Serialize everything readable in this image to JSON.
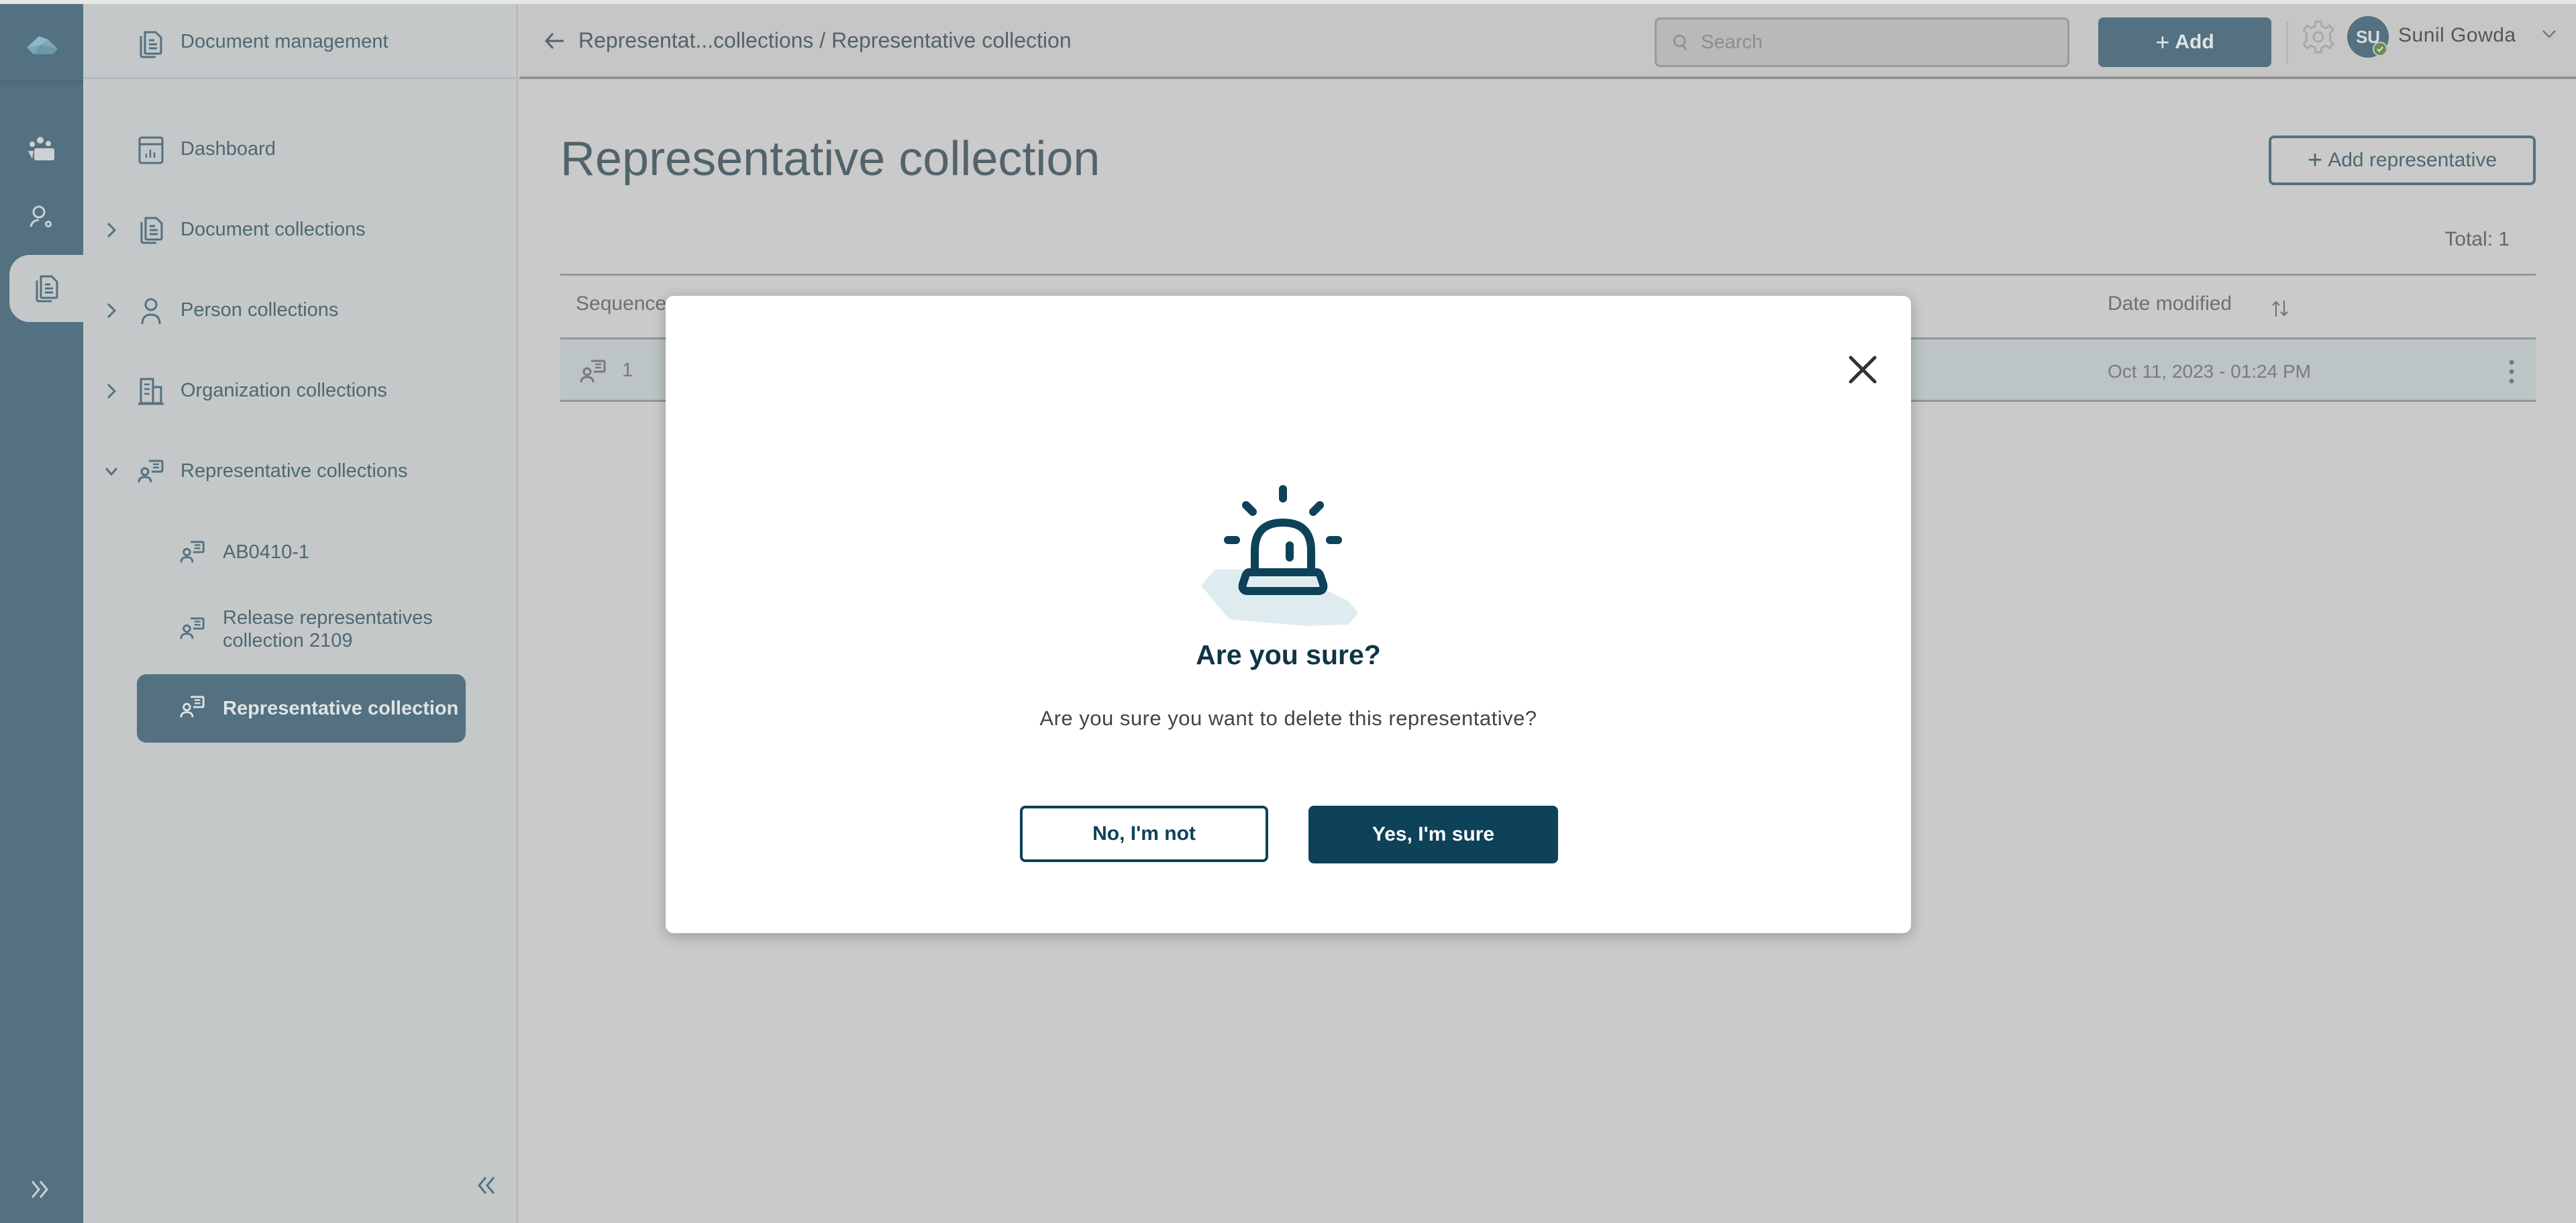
{
  "app": {
    "section_title": "Document management"
  },
  "rail": {
    "items": [
      {
        "icon": "users-folder-icon",
        "active": false
      },
      {
        "icon": "user-settings-icon",
        "active": false
      },
      {
        "icon": "documents-icon",
        "active": true
      }
    ]
  },
  "sidebar": {
    "items": [
      {
        "label": "Dashboard",
        "icon": "dashboard-icon",
        "expandable": false
      },
      {
        "label": "Document collections",
        "icon": "documents-icon",
        "expandable": true,
        "expanded": false
      },
      {
        "label": "Person collections",
        "icon": "person-icon",
        "expandable": true,
        "expanded": false
      },
      {
        "label": "Organization collections",
        "icon": "building-icon",
        "expandable": true,
        "expanded": false
      },
      {
        "label": "Representative collections",
        "icon": "representative-icon",
        "expandable": true,
        "expanded": true
      }
    ],
    "sub_items": [
      {
        "label": "AB0410-1",
        "active": false
      },
      {
        "label": "Release representatives collection 2109",
        "active": false
      },
      {
        "label": "Representative collection",
        "active": true
      }
    ]
  },
  "header": {
    "breadcrumb_parent": "Representat...collections",
    "breadcrumb_separator": " / ",
    "breadcrumb_current": "Representative collection",
    "search_placeholder": "Search",
    "search_value": "",
    "add_label": "Add",
    "user_initials": "SU",
    "user_name": "Sunil Gowda",
    "status_color": "#6e8b55"
  },
  "main": {
    "title": "Representative collection",
    "add_representative_label": "Add representative",
    "total_label": "Total: 1",
    "columns": [
      "Sequence",
      "Date modified"
    ],
    "rows": [
      {
        "sequence": "1",
        "date_modified": "Oct 11, 2023 - 01:24 PM"
      }
    ]
  },
  "modal": {
    "title": "Are you sure?",
    "message": "Are you sure you want to delete this representative?",
    "cancel_label": "No, I'm not",
    "confirm_label": "Yes, I'm sure",
    "accent_color": "#0d4258"
  }
}
